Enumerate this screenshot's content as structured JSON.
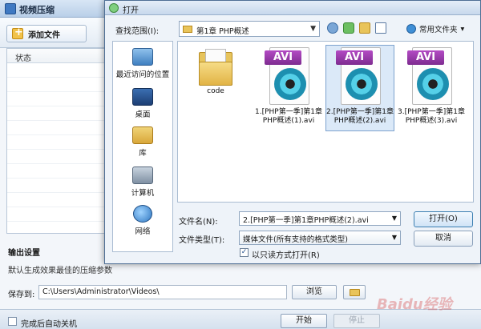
{
  "app": {
    "title": "视频压缩",
    "add_file_label": "添加文件",
    "list_header": "状态",
    "output_title": "输出设置",
    "output_desc": "默认生成效果最佳的压缩参数",
    "save_label": "保存到:",
    "save_path": "C:\\Users\\Administrator\\Videos\\",
    "browse_label": "浏览",
    "auto_shutdown_label": "完成后自动关机",
    "start_label": "开始",
    "stop_label": "停止",
    "watermark": "Baidu经验"
  },
  "dialog": {
    "title": "打开",
    "look_in_label": "查找范围(I):",
    "look_in_value": "第1章 PHP概述",
    "favorites_label": "常用文件夹",
    "places": [
      {
        "label": "最近访问的位置"
      },
      {
        "label": "桌面"
      },
      {
        "label": "库"
      },
      {
        "label": "计算机"
      },
      {
        "label": "网络"
      }
    ],
    "files": [
      {
        "name": "code",
        "type": "folder"
      },
      {
        "name": "1.[PHP第一季]第1章PHP概述(1).avi",
        "type": "avi",
        "badge": "AVI"
      },
      {
        "name": "2.[PHP第一季]第1章PHP概述(2).avi",
        "type": "avi",
        "badge": "AVI",
        "selected": true
      },
      {
        "name": "3.[PHP第一季]第1章PHP概述(3).avi",
        "type": "avi",
        "badge": "AVI"
      }
    ],
    "file_name_label": "文件名(N):",
    "file_name_value": "2.[PHP第一季]第1章PHP概述(2).avi",
    "file_type_label": "文件类型(T):",
    "file_type_value": "媒体文件(所有支持的格式类型)",
    "readonly_label": "以只读方式打开(R)",
    "open_label": "打开(O)",
    "cancel_label": "取消"
  }
}
